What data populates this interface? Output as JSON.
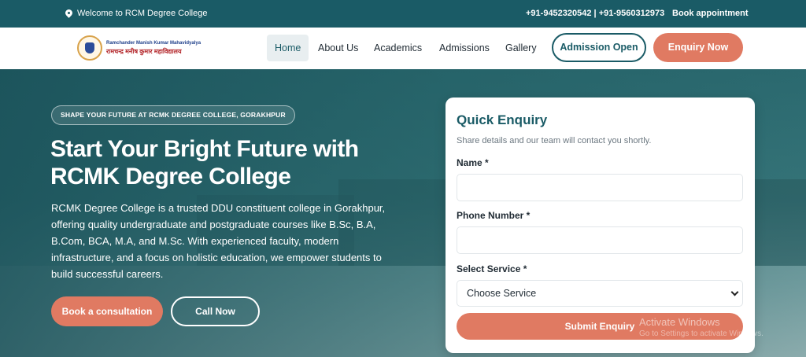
{
  "topbar": {
    "welcome": "Welcome to RCM Degree College",
    "phones": "+91-9452320542 | +91-9560312973",
    "book_link": "Book appointment"
  },
  "logo": {
    "name_en": "Ramchander Manish Kumar Mahavidyalya",
    "name_hi": "रामचन्द्र मनीष कुमार महाविद्यालय"
  },
  "nav": {
    "items": [
      {
        "label": "Home",
        "active": true
      },
      {
        "label": "About Us",
        "active": false
      },
      {
        "label": "Academics",
        "active": false
      },
      {
        "label": "Admissions",
        "active": false
      },
      {
        "label": "Gallery",
        "active": false
      }
    ],
    "admission_open": "Admission Open",
    "enquiry_now": "Enquiry Now"
  },
  "hero": {
    "badge": "SHAPE YOUR FUTURE AT RCMK DEGREE COLLEGE, GORAKHPUR",
    "headline_line1": "Start Your Bright Future with",
    "headline_line2": "RCMK Degree College",
    "description": "RCMK Degree College is a trusted DDU constituent college in Gorakhpur, offering quality undergraduate and postgraduate courses like B.Sc, B.A, B.Com, BCA, M.A, and M.Sc. With experienced faculty, modern infrastructure, and a focus on holistic education, we empower students to build successful careers.",
    "cta_consult": "Book a consultation",
    "cta_call": "Call Now"
  },
  "enquiry": {
    "title": "Quick Enquiry",
    "subtitle": "Share details and our team will contact you shortly.",
    "name_label": "Name *",
    "name_value": "",
    "phone_label": "Phone Number *",
    "phone_value": "",
    "service_label": "Select Service *",
    "service_selected": "Choose Service",
    "submit": "Submit Enquiry"
  },
  "watermark": {
    "line1": "Activate Windows",
    "line2": "Go to Settings to activate Windows."
  },
  "colors": {
    "brand_teal": "#1a5b66",
    "accent_coral": "#e07a62"
  }
}
